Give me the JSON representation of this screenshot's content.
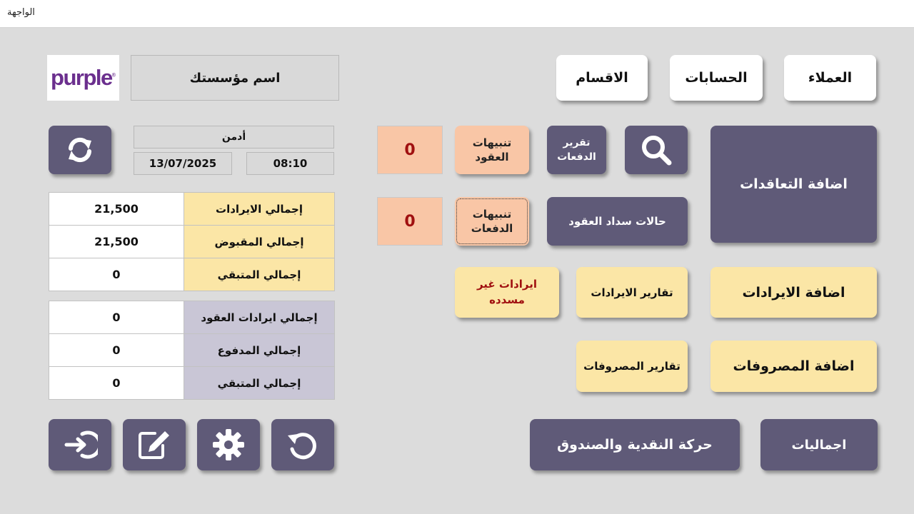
{
  "window": {
    "title": "الواجهة"
  },
  "header": {
    "logo_text": "purple",
    "logo_mark": "®",
    "org_name": "اسم مؤسستك"
  },
  "nav": {
    "customers": "العملاء",
    "accounts": "الحسابات",
    "departments": "الاقسام"
  },
  "user": {
    "name": "أدمن",
    "date": "13/07/2025",
    "time": "08:10"
  },
  "stats_income": [
    {
      "label": "إجمالي الايرادات",
      "value": "21,500"
    },
    {
      "label": "إجمالي المقبوض",
      "value": "21,500"
    },
    {
      "label": "إجمالي المتبقي",
      "value": "0"
    }
  ],
  "stats_contracts": [
    {
      "label": "إجمالي ايرادات العقود",
      "value": "0"
    },
    {
      "label": "إجمالي المدفوع",
      "value": "0"
    },
    {
      "label": "إجمالي المتبقي",
      "value": "0"
    }
  ],
  "actions": {
    "add_contracts": "اضافة التعاقدات",
    "payments_report_line1": "تقرير",
    "payments_report_line2": "الدفعات",
    "contract_alerts_line1": "تنبيهات",
    "contract_alerts_line2": "العقود",
    "contract_alerts_count": "0",
    "payment_alerts_line1": "تنبيهات",
    "payment_alerts_line2": "الدفعات",
    "payment_alerts_count": "0",
    "contract_payment_status": "حالات سداد العقود",
    "add_revenue": "اضافة الايرادات",
    "revenue_reports": "تقارير الايرادات",
    "unpaid_revenue_line1": "ايرادات غير",
    "unpaid_revenue_line2": "مسدده",
    "add_expenses": "اضافة المصروفات",
    "expense_reports": "تقارير المصروفات",
    "totals": "اجماليات",
    "cash_movement": "حركة النقدية والصندوق"
  },
  "icons": {
    "refresh": "refresh-icon",
    "search": "search-icon",
    "logout": "logout-icon",
    "edit": "edit-icon",
    "settings": "gear-icon",
    "undo": "undo-icon"
  },
  "colors": {
    "purple": "#5f5a78",
    "yellow": "#fbe6a6",
    "peach": "#f9c6a6",
    "lavender": "#c9c6d6",
    "alert_red": "#a01010",
    "logo": "#6b2f8e"
  }
}
